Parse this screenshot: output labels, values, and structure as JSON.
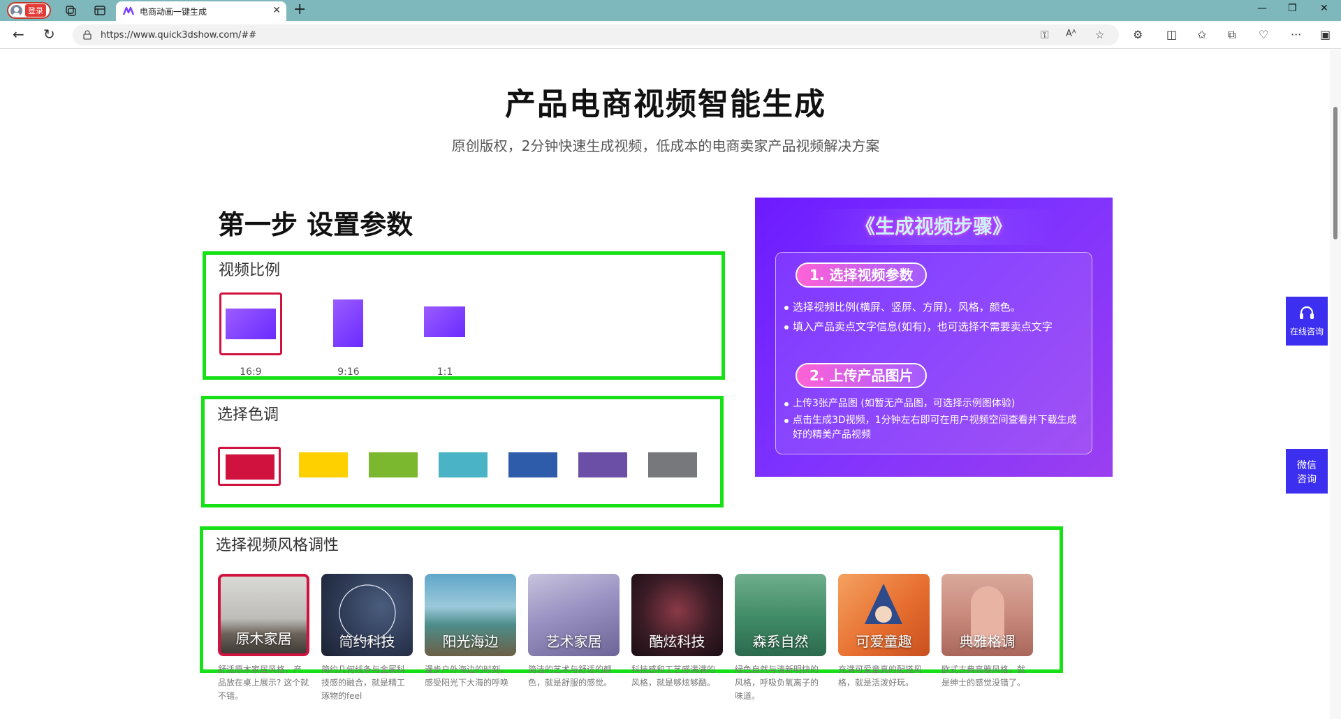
{
  "browser": {
    "login_label": "登录",
    "tab_title": "电商动画一键生成",
    "url": "https://www.quick3dshow.com/##"
  },
  "hero": {
    "title": "产品电商视频智能生成",
    "subtitle": "原创版权，2分钟快速生成视频，低成本的电商卖家产品视频解决方案"
  },
  "step": {
    "title": "第一步 设置参数"
  },
  "ratio": {
    "label": "视频比例",
    "options": [
      {
        "label": "16:9",
        "selected": true
      },
      {
        "label": "9:16",
        "selected": false
      },
      {
        "label": "1:1",
        "selected": false
      }
    ]
  },
  "tone": {
    "label": "选择色调",
    "colors": [
      "#d0123e",
      "#ffd000",
      "#7cb82f",
      "#4ab3c5",
      "#2e5caa",
      "#6b4ea6",
      "#77787b"
    ],
    "selected_index": 0
  },
  "style": {
    "label": "选择视频风格调性",
    "items": [
      {
        "name": "原木家居",
        "desc": "舒适原木家居风格，产品放在桌上展示? 这个就不错。",
        "selected": true
      },
      {
        "name": "简约科技",
        "desc": "简约几何线条与金属科技感的融合，就是精工琢物的feel"
      },
      {
        "name": "阳光海边",
        "desc": "漫步户外海边的时刻，感受阳光下大海的呼唤"
      },
      {
        "name": "艺术家居",
        "desc": "简洁的艺术与舒适的颜色，就是舒服的感觉。"
      },
      {
        "name": "酷炫科技",
        "desc": "科技感和工艺感满满的风格，就是够炫够酷。"
      },
      {
        "name": "森系自然",
        "desc": "绿色自然与清新明快的风格，呼吸负氧离子的味道。"
      },
      {
        "name": "可爱童趣",
        "desc": "充满可爱童真的配搭风格，就是活泼好玩。"
      },
      {
        "name": "典雅格调",
        "desc": "欧式古典高雅风格，就是绅士的感觉没错了。"
      }
    ]
  },
  "promo": {
    "heading": "《生成视频步骤》",
    "step1": "1. 选择视频参数",
    "step1_items": [
      "选择视频比例(横屏、竖屏、方屏)，风格，颜色。",
      "填入产品卖点文字信息(如有)，也可选择不需要卖点文字"
    ],
    "step2": "2. 上传产品图片",
    "step2_items": [
      "上传3张产品图 (如暂无产品图，可选择示例图体验)",
      "点击生成3D视频，1分钟左右即可在用户视频空间查看并下载生成好的精美产品视频"
    ]
  },
  "float": {
    "online": "在线咨询",
    "wechat": "微信咨询"
  },
  "icons": [
    "user-avatar-icon",
    "workspaces-icon",
    "tab-actions-icon",
    "app-logo-icon",
    "close-icon",
    "plus-icon",
    "back-icon",
    "refresh-icon",
    "info-icon",
    "key-icon",
    "read-aloud-icon",
    "star-icon",
    "extensions-icon",
    "split-screen-icon",
    "favorites-icon",
    "collections-icon",
    "performance-icon",
    "more-icon",
    "sidebar-icon",
    "headset-icon"
  ]
}
